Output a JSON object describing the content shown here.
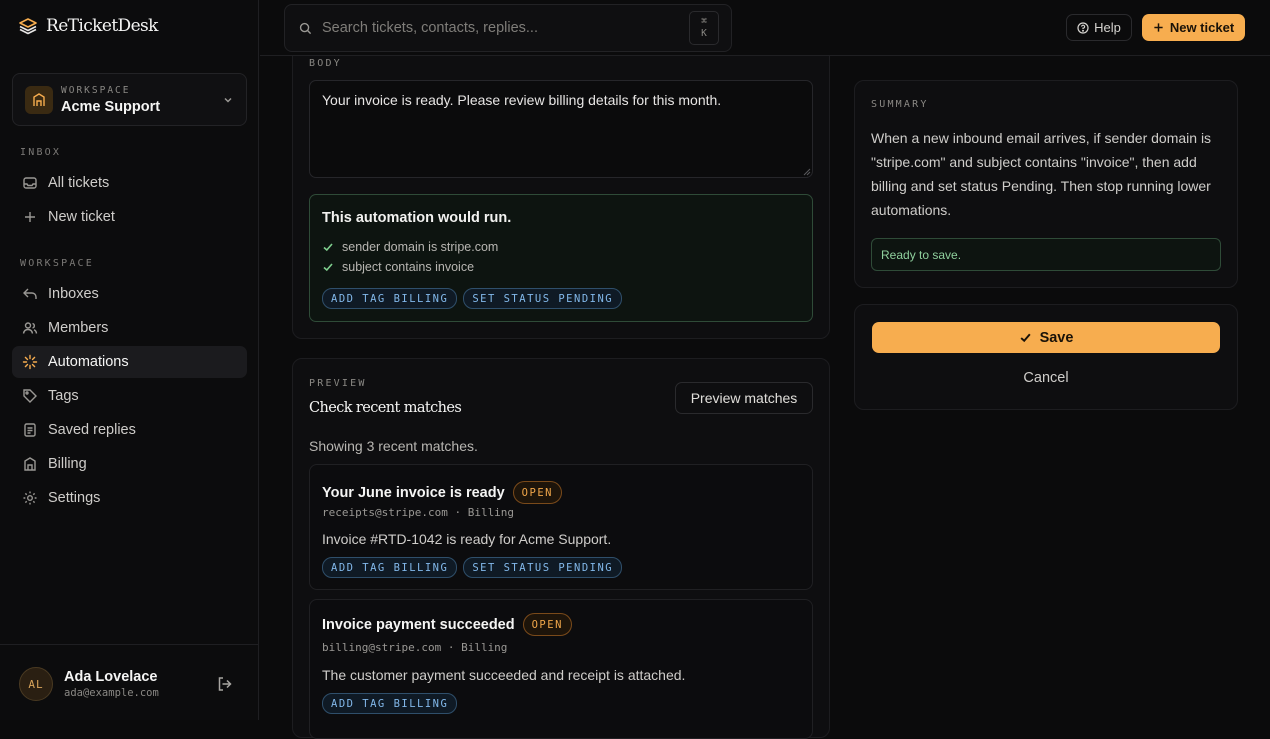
{
  "brand": {
    "name": "ReTicketDesk",
    "logo_icon": "layers-icon",
    "accent": "#f7ad4f"
  },
  "workspace_switcher": {
    "kicker": "WORKSPACE",
    "name": "Acme Support"
  },
  "sidebar": {
    "inbox_label": "INBOX",
    "inbox_items": [
      {
        "label": "All tickets",
        "icon": "inbox-icon"
      },
      {
        "label": "New ticket",
        "icon": "plus-icon"
      }
    ],
    "workspace_label": "WORKSPACE",
    "workspace_items": [
      {
        "label": "Inboxes",
        "icon": "reply-icon"
      },
      {
        "label": "Members",
        "icon": "users-icon"
      },
      {
        "label": "Automations",
        "icon": "sparkle-icon",
        "active": true
      },
      {
        "label": "Tags",
        "icon": "tag-icon"
      },
      {
        "label": "Saved replies",
        "icon": "document-icon"
      },
      {
        "label": "Billing",
        "icon": "building-icon"
      },
      {
        "label": "Settings",
        "icon": "gear-icon"
      }
    ]
  },
  "user": {
    "initials": "AL",
    "name": "Ada Lovelace",
    "email": "ada@example.com"
  },
  "topbar": {
    "search_placeholder": "Search tickets, contacts, replies...",
    "shortcut_line1": "⌘",
    "shortcut_line2": "K",
    "help_label": "Help",
    "new_ticket_label": "New ticket"
  },
  "editor": {
    "body_label": "BODY",
    "body_value": "Your invoice is ready. Please review billing details for this month.",
    "result_title": "This automation would run.",
    "checks": [
      "sender domain is stripe.com",
      "subject contains invoice"
    ],
    "actions": [
      "ADD TAG BILLING",
      "SET STATUS PENDING"
    ]
  },
  "preview": {
    "kicker": "PREVIEW",
    "title": "Check recent matches",
    "button_label": "Preview matches",
    "count_text": "Showing 3 recent matches.",
    "matches": [
      {
        "title": "Your June invoice is ready",
        "status": "OPEN",
        "meta": "receipts@stripe.com · Billing",
        "body": "Invoice #RTD-1042 is ready for Acme Support.",
        "actions": [
          "ADD TAG BILLING",
          "SET STATUS PENDING"
        ]
      },
      {
        "title": "Invoice payment succeeded",
        "status": "OPEN",
        "meta": "billing@stripe.com · Billing",
        "body": "The customer payment succeeded and receipt is attached.",
        "actions": [
          "ADD TAG BILLING"
        ]
      }
    ]
  },
  "summary": {
    "kicker": "SUMMARY",
    "text": "When a new inbound email arrives, if sender domain is \"stripe.com\" and subject contains \"invoice\", then add billing and set status Pending. Then stop running lower automations.",
    "status": "Ready to save."
  },
  "actions_panel": {
    "save_label": "Save",
    "cancel_label": "Cancel"
  }
}
